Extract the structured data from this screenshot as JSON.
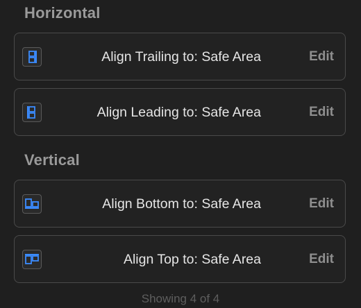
{
  "sections": {
    "horizontal": {
      "title": "Horizontal",
      "rows": [
        {
          "constraint": "Align Trailing to:  Safe Area",
          "edit": "Edit",
          "icon": "align-trailing-icon"
        },
        {
          "constraint": "Align Leading to:  Safe Area",
          "edit": "Edit",
          "icon": "align-leading-icon"
        }
      ]
    },
    "vertical": {
      "title": "Vertical",
      "rows": [
        {
          "constraint": "Align Bottom to:  Safe Area",
          "edit": "Edit",
          "icon": "align-bottom-icon"
        },
        {
          "constraint": "Align Top to:  Safe Area",
          "edit": "Edit",
          "icon": "align-top-icon"
        }
      ]
    }
  },
  "footer": "Showing 4 of 4",
  "colors": {
    "accent": "#3b8cff",
    "background": "#1f1f1f",
    "border": "#4a4a4a"
  }
}
